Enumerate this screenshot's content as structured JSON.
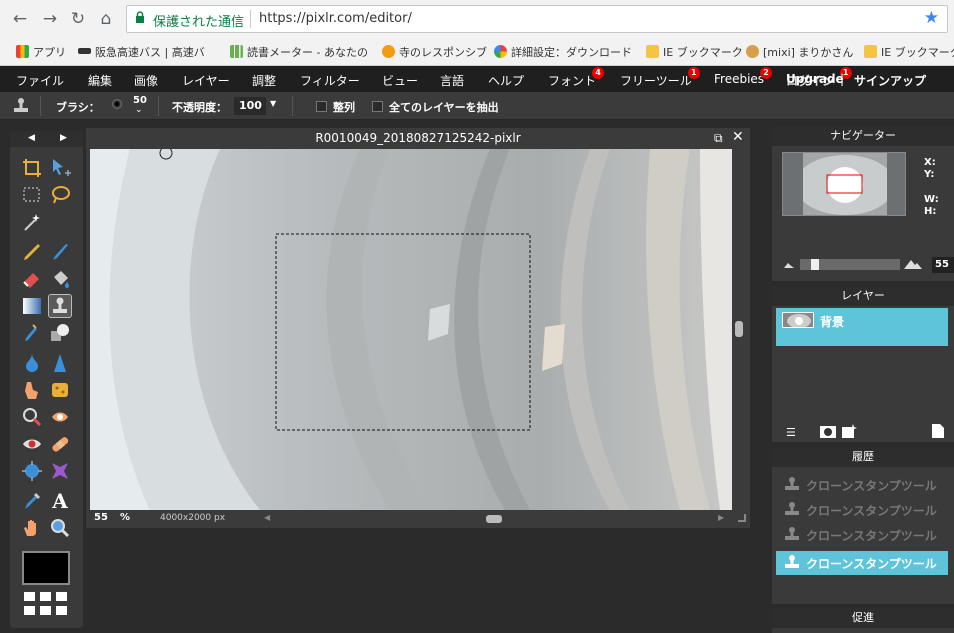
{
  "browser": {
    "secure_label": "保護された通信",
    "url": "https://pixlr.com/editor/",
    "bookmarks": [
      {
        "label": "アプリ",
        "icon": "apps-grid-icon"
      },
      {
        "label": "阪急高速バス | 高速バ",
        "icon": "bus-icon"
      },
      {
        "label": "読書メーター - あなたの",
        "icon": "bar-chart-icon"
      },
      {
        "label": "寺のレスポンシブ",
        "icon": "site-icon"
      },
      {
        "label": "詳細設定：ダウンロード",
        "icon": "google-icon"
      },
      {
        "label": "IE ブックマーク",
        "icon": "folder-icon"
      },
      {
        "label": "[mixi] まりかさん",
        "icon": "mixi-icon"
      },
      {
        "label": "IE ブックマーク (",
        "icon": "folder-icon"
      }
    ]
  },
  "menubar": {
    "items": [
      "ファイル",
      "編集",
      "画像",
      "レイヤー",
      "調整",
      "フィルター",
      "ビュー",
      "言語",
      "ヘルプ"
    ],
    "font": {
      "label": "フォント",
      "badge": "4"
    },
    "freetools": {
      "label": "フリーツール",
      "badge": "1"
    },
    "freebies": {
      "label": "Freebies",
      "badge": "2"
    },
    "upgrade": {
      "label": "Upgrade",
      "badge": "1"
    },
    "login": "ログイン",
    "divider": "|",
    "signup": "サインアップ"
  },
  "options": {
    "brush_label": "ブラシ：",
    "brush_size": "50",
    "opacity_label": "不透明度：",
    "opacity_value": "100",
    "align_label": "整列",
    "all_layers_label": "全てのレイヤーを抽出"
  },
  "document": {
    "title": "R0010049_20180827125242-pixlr",
    "zoom": "55",
    "zoom_unit": "%",
    "size": "4000x2000 px"
  },
  "navigator": {
    "title": "ナビゲーター",
    "x_label": "X:",
    "y_label": "Y:",
    "w_label": "W:",
    "h_label": "H:",
    "zoom": "55",
    "slider_level": 0.12
  },
  "layers": {
    "title": "レイヤー",
    "items": [
      {
        "name": "背景"
      }
    ]
  },
  "history": {
    "title": "履歴",
    "items": [
      "クローンスタンプツール",
      "クローンスタンプツール",
      "クローンスタンプツール",
      "クローンスタンプツール"
    ]
  },
  "next_panel": {
    "title": "促進"
  },
  "colors": {
    "accent": "#5ec4da",
    "menubar": "#1f1f1f",
    "panel": "#3a3a3a"
  }
}
